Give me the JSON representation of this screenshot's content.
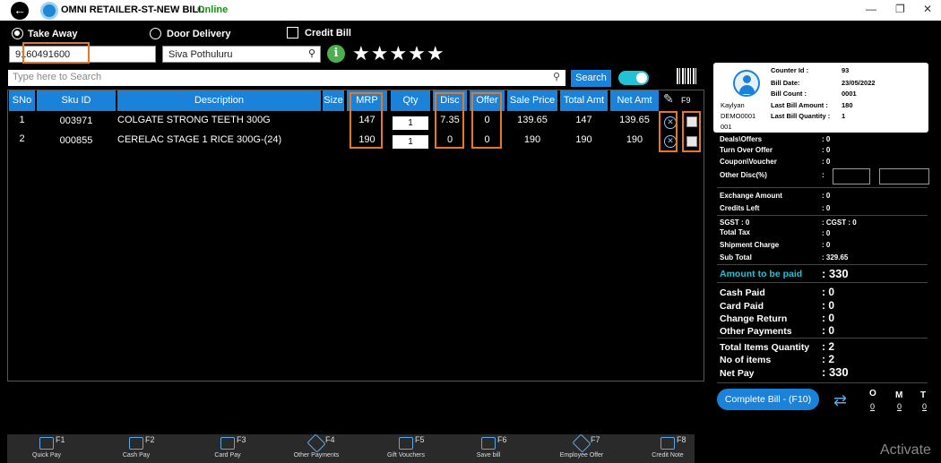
{
  "app": {
    "title": "OMNI RETAILER-ST-NEW BILL",
    "status": "Online"
  },
  "window_controls": {
    "minimize": "—",
    "maximize": "❐",
    "close": "✕"
  },
  "order_type": {
    "take_away": "Take Away",
    "door_delivery": "Door Delivery",
    "credit_bill": "Credit Bill"
  },
  "customer": {
    "phone": "9160491600",
    "name": "Siva Pothuluru",
    "rating_stars": "★★★★★"
  },
  "search": {
    "placeholder": "Type here to Search",
    "button": "Search"
  },
  "table": {
    "headers": [
      "SNo",
      "Sku ID",
      "Description",
      "Size",
      "MRP",
      "Qty",
      "Disc",
      "Offer",
      "Sale Price",
      "Total Amt",
      "Net Amt"
    ],
    "f9": "F9",
    "rows": [
      {
        "sno": "1",
        "sku": "003971",
        "desc": "COLGATE STRONG TEETH 300G",
        "mrp": "147",
        "qty": "1",
        "disc": "7.35",
        "offer": "0",
        "sale": "139.65",
        "total": "147",
        "net": "139.65"
      },
      {
        "sno": "2",
        "sku": "000855",
        "desc": "CERELAC STAGE 1 RICE 300G-(24)",
        "mrp": "190",
        "qty": "1",
        "disc": "0",
        "offer": "0",
        "sale": "190",
        "total": "190",
        "net": "190"
      }
    ]
  },
  "counter": {
    "user": "Kaylyan",
    "user_id": "DEMO0001",
    "counter_no": "001",
    "counter_id_label": "Counter Id :",
    "counter_id": "93",
    "bill_date_label": "Bill Date:",
    "bill_date": "23/05/2022",
    "bill_count_label": "Bill Count :",
    "bill_count": "0001",
    "last_amount_label": "Last Bill Amount :",
    "last_amount": "180",
    "last_qty_label": "Last Bill Quantity :",
    "last_qty": "1"
  },
  "summary": {
    "deals_label": "Deals\\Offers",
    "deals": ": 0",
    "turnover_label": "Turn Over Offer",
    "turnover": ": 0",
    "coupon_label": "Coupon\\Voucher",
    "coupon": ": 0",
    "other_disc_label": "Other Disc(%)",
    "other_disc": ":",
    "exchange_label": "Exchange Amount",
    "exchange": ": 0",
    "credits_label": "Credits Left",
    "credits": ": 0",
    "sgst_label": "SGST : 0",
    "cgst_label": ": CGST : 0",
    "total_tax_label": "Total Tax",
    "total_tax": ": 0",
    "shipment_label": "Shipment Charge",
    "shipment": ": 0",
    "subtotal_label": "Sub Total",
    "subtotal": ": 329.65",
    "amount_paid_label": "Amount to be paid",
    "amount_paid": ": 330",
    "cash_paid_label": "Cash Paid",
    "cash_paid": ": 0",
    "card_paid_label": "Card Paid",
    "card_paid": ": 0",
    "change_return_label": "Change Return",
    "change_return": ": 0",
    "other_payments_label": "Other Payments",
    "other_payments": ": 0",
    "total_qty_label": "Total Items Quantity",
    "total_qty": ": 2",
    "no_items_label": "No of items",
    "no_items": ": 2",
    "net_pay_label": "Net Pay",
    "net_pay": ": 330"
  },
  "complete": {
    "label": "Complete Bill - (F10)"
  },
  "omt": {
    "o": "O",
    "m": "M",
    "t": "T",
    "o_val": "0",
    "m_val": "0",
    "t_val": "0"
  },
  "footer": [
    {
      "key": "F1",
      "label": "Quick Pay"
    },
    {
      "key": "F2",
      "label": "Cash Pay"
    },
    {
      "key": "F3",
      "label": "Card Pay"
    },
    {
      "key": "F4",
      "label": "Other Payments"
    },
    {
      "key": "F5",
      "label": "Gift Vouchers"
    },
    {
      "key": "F6",
      "label": "Save bill"
    },
    {
      "key": "F7",
      "label": "Employee Offer"
    },
    {
      "key": "F8",
      "label": "Credit Note"
    }
  ],
  "watermark": "Activate"
}
